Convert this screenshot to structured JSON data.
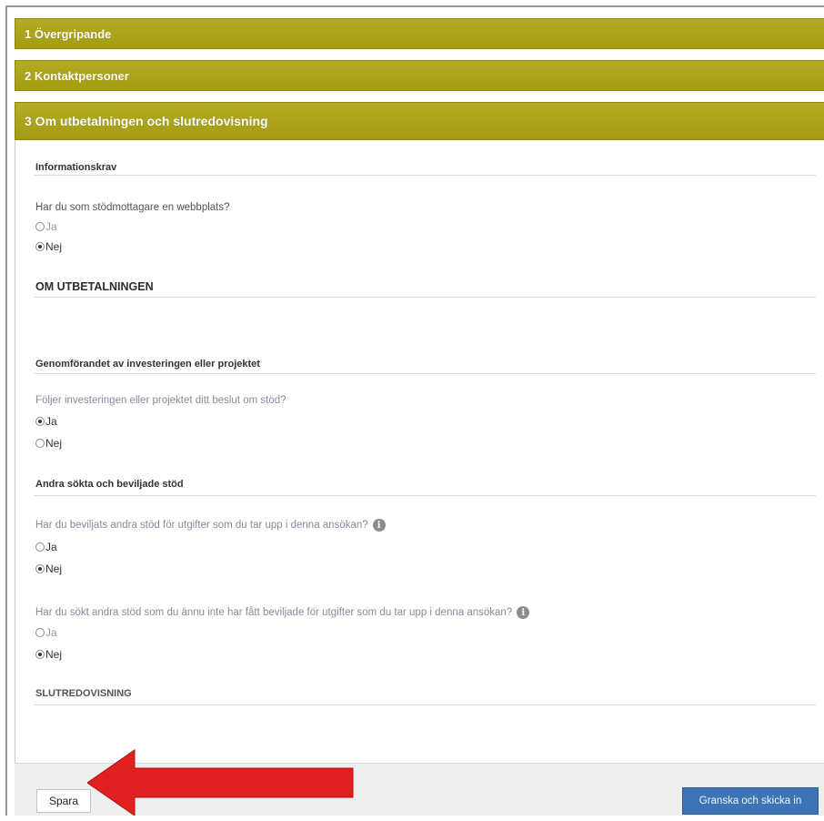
{
  "accordion": [
    {
      "label": "1 Övergripande"
    },
    {
      "label": "2 Kontaktpersoner"
    },
    {
      "label": "3 Om utbetalningen och slutredovisning"
    }
  ],
  "sections": {
    "info_krav": "Informationskrav",
    "om_utbetalningen": "OM UTBETALNINGEN",
    "genomforandet": "Genomförandet av investeringen eller projektet",
    "andra_stod": "Andra sökta och beviljade stöd",
    "slutredovisning": "SLUTREDOVISNING"
  },
  "questions": [
    {
      "text": "Har du som stödmottagare en webbplats?",
      "options": [
        "Ja",
        "Nej"
      ],
      "selected": "Nej"
    },
    {
      "text": "Följer investeringen eller projektet ditt beslut om stöd?",
      "options": [
        "Ja",
        "Nej"
      ],
      "selected": "Ja"
    },
    {
      "text": "Har du beviljats andra stöd för utgifter som du tar upp i denna ansökan?",
      "options": [
        "Ja",
        "Nej"
      ],
      "selected": "Nej",
      "info_icon": "info-icon"
    },
    {
      "text": "Har du sökt andra stöd som du ännu inte har fått beviljade för utgifter som du tar upp i denna ansökan?",
      "options": [
        "Ja",
        "Nej"
      ],
      "selected": "Nej",
      "info_icon": "info-icon"
    }
  ],
  "info_icon_glyph": "i",
  "footer": {
    "save_label": "Spara",
    "submit_label": "Granska och skicka in"
  },
  "colors": {
    "accordion": "#a8a01a",
    "submit": "#3d74b6",
    "arrow": "#e02020"
  }
}
